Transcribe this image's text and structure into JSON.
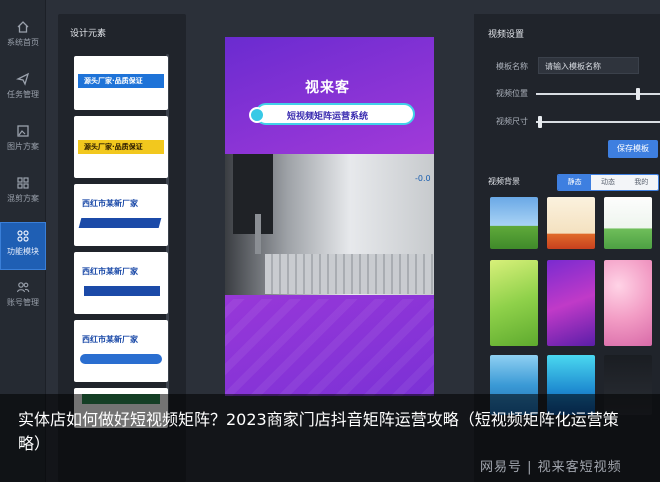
{
  "nav": {
    "items": [
      {
        "label": "系统首页",
        "icon": "home-icon"
      },
      {
        "label": "任务管理",
        "icon": "send-icon"
      },
      {
        "label": "图片方案",
        "icon": "image-icon"
      },
      {
        "label": "混剪方案",
        "icon": "grid-icon"
      },
      {
        "label": "功能模块",
        "icon": "modules-icon",
        "active": true
      },
      {
        "label": "账号管理",
        "icon": "users-icon"
      }
    ]
  },
  "elements_panel": {
    "title": "设计元素",
    "cards": [
      {
        "text": "源头厂家·品质保证"
      },
      {
        "text": "源头厂家·品质保证"
      },
      {
        "text": "西红市某新厂家"
      },
      {
        "text": "西红市某新厂家"
      },
      {
        "text": "西红市某新厂家"
      },
      {
        "text": ""
      }
    ]
  },
  "canvas": {
    "title": "视来客",
    "banner": "短视频矩阵运营系统",
    "overlay_number": "-0.0"
  },
  "settings": {
    "title": "视频设置",
    "template_name_label": "模板名称",
    "template_name_placeholder": "请输入模板名称",
    "position_label": "视频位置",
    "size_label": "视频尺寸",
    "position_value": 0.83,
    "size_value": 0.02,
    "save_label": "保存模板",
    "background_label": "视频背景",
    "tabs": [
      {
        "label": "静态",
        "active": true
      },
      {
        "label": "动态"
      },
      {
        "label": "我的"
      }
    ]
  },
  "caption": {
    "text": "实体店如何做好短视频矩阵？2023商家门店抖音矩阵运营攻略（短视频矩阵化运营策略）"
  },
  "watermark": "网易号 | 视来客短视频"
}
